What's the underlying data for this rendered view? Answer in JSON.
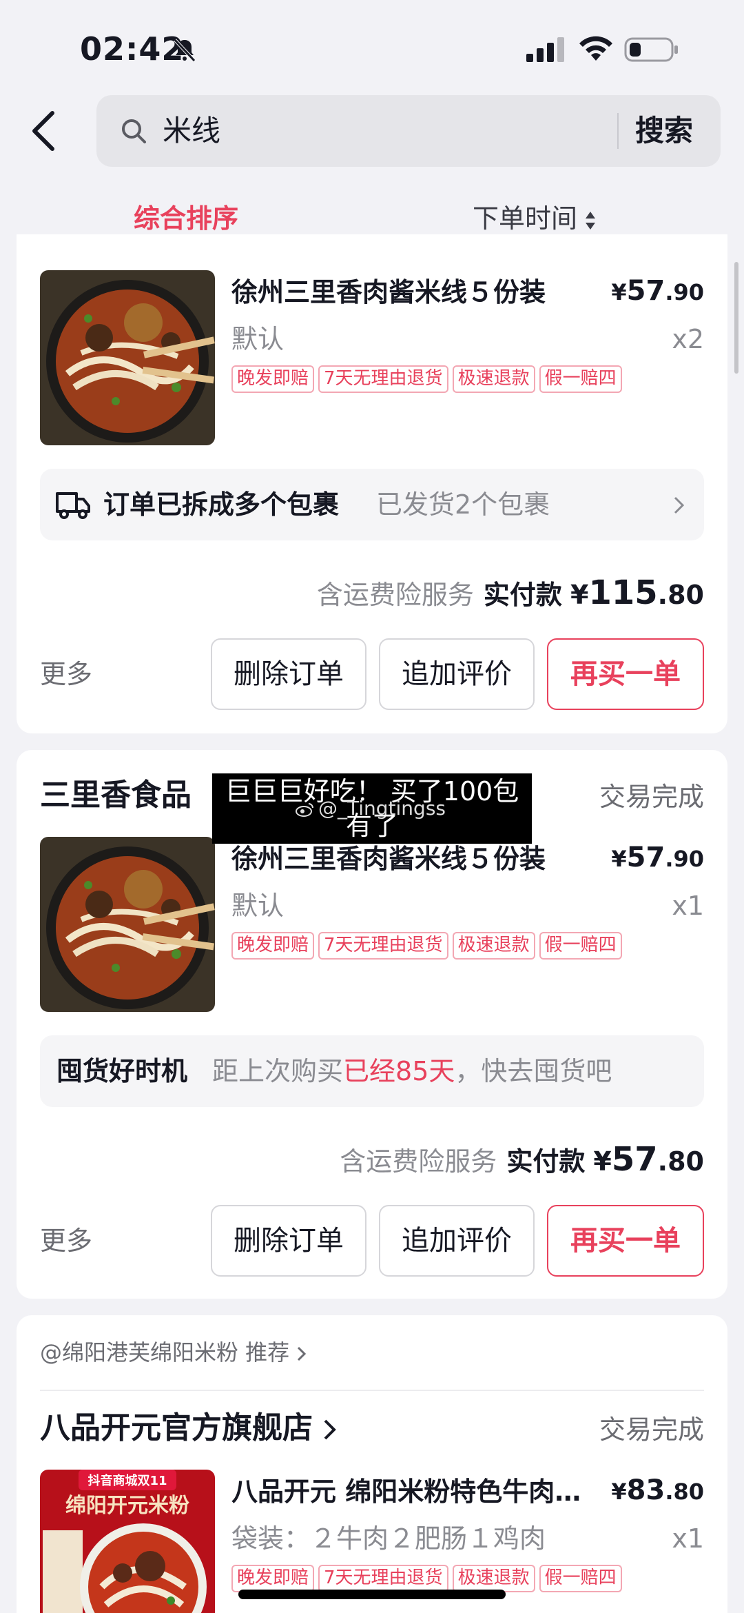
{
  "status": {
    "time": "02:42"
  },
  "search": {
    "query": "米线",
    "button": "搜索"
  },
  "sort": {
    "active": "综合排序",
    "other": "下单时间"
  },
  "order1": {
    "product_title": "徐州三里香肉酱米线５份装",
    "price_symbol": "¥",
    "price_int": "57",
    "price_dec": ".90",
    "spec": "默认",
    "qty": "x2",
    "tags": [
      "晚发即赔",
      "7天无理由退货",
      "极速退款",
      "假一赔四"
    ],
    "package_text": "订单已拆成多个包裹",
    "package_status": "已发货2个包裹",
    "service": "含运费险服务",
    "paid_label": "实付款",
    "paid_symbol": "¥",
    "paid_int": "115",
    "paid_dec": ".80",
    "more": "更多",
    "btn_delete": "删除订单",
    "btn_review": "追加评价",
    "btn_rebuy": "再买一单"
  },
  "order2": {
    "shop": "三里香食品",
    "status": "交易完成",
    "caption_line1": "巨巨巨好吃！ 买了100包",
    "caption_line2": "有了",
    "caption_watermark": "@_Tingtingss",
    "product_title": "徐州三里香肉酱米线５份装",
    "price_symbol": "¥",
    "price_int": "57",
    "price_dec": ".90",
    "spec": "默认",
    "qty": "x1",
    "tags": [
      "晚发即赔",
      "7天无理由退货",
      "极速退款",
      "假一赔四"
    ],
    "stock_title": "囤货好时机",
    "stock_pre": "距上次购买",
    "stock_highlight": "已经85天",
    "stock_post": "，快去囤货吧",
    "service": "含运费险服务",
    "paid_label": "实付款",
    "paid_symbol": "¥",
    "paid_int": "57",
    "paid_dec": ".80",
    "more": "更多",
    "btn_delete": "删除订单",
    "btn_review": "追加评价",
    "btn_rebuy": "再买一单"
  },
  "order3": {
    "recommend": "@绵阳港芙绵阳米粉 推荐",
    "shop": "八品开元官方旗舰店",
    "status": "交易完成",
    "thumb_banner": "抖音商城双11",
    "thumb_headline": "绵阳开元米粉",
    "product_title": "八品开元 绵阳米粉特色牛肉米粉",
    "price_symbol": "¥",
    "price_int": "83",
    "price_dec": ".80",
    "spec": "袋装：２牛肉２肥肠１鸡肉",
    "qty": "x1",
    "tags": [
      "晚发即赔",
      "7天无理由退货",
      "极速退款",
      "假一赔四"
    ]
  },
  "colors": {
    "accent": "#e8415c",
    "page_bg": "#f2f2f6",
    "text": "#161823",
    "muted": "#8a8b91"
  },
  "icons": [
    "bell-slash-icon",
    "signal-icon",
    "wifi-icon",
    "battery-icon",
    "back-arrow-icon",
    "search-icon",
    "sort-arrows-icon",
    "truck-icon",
    "chevron-right-icon",
    "weibo-icon"
  ]
}
